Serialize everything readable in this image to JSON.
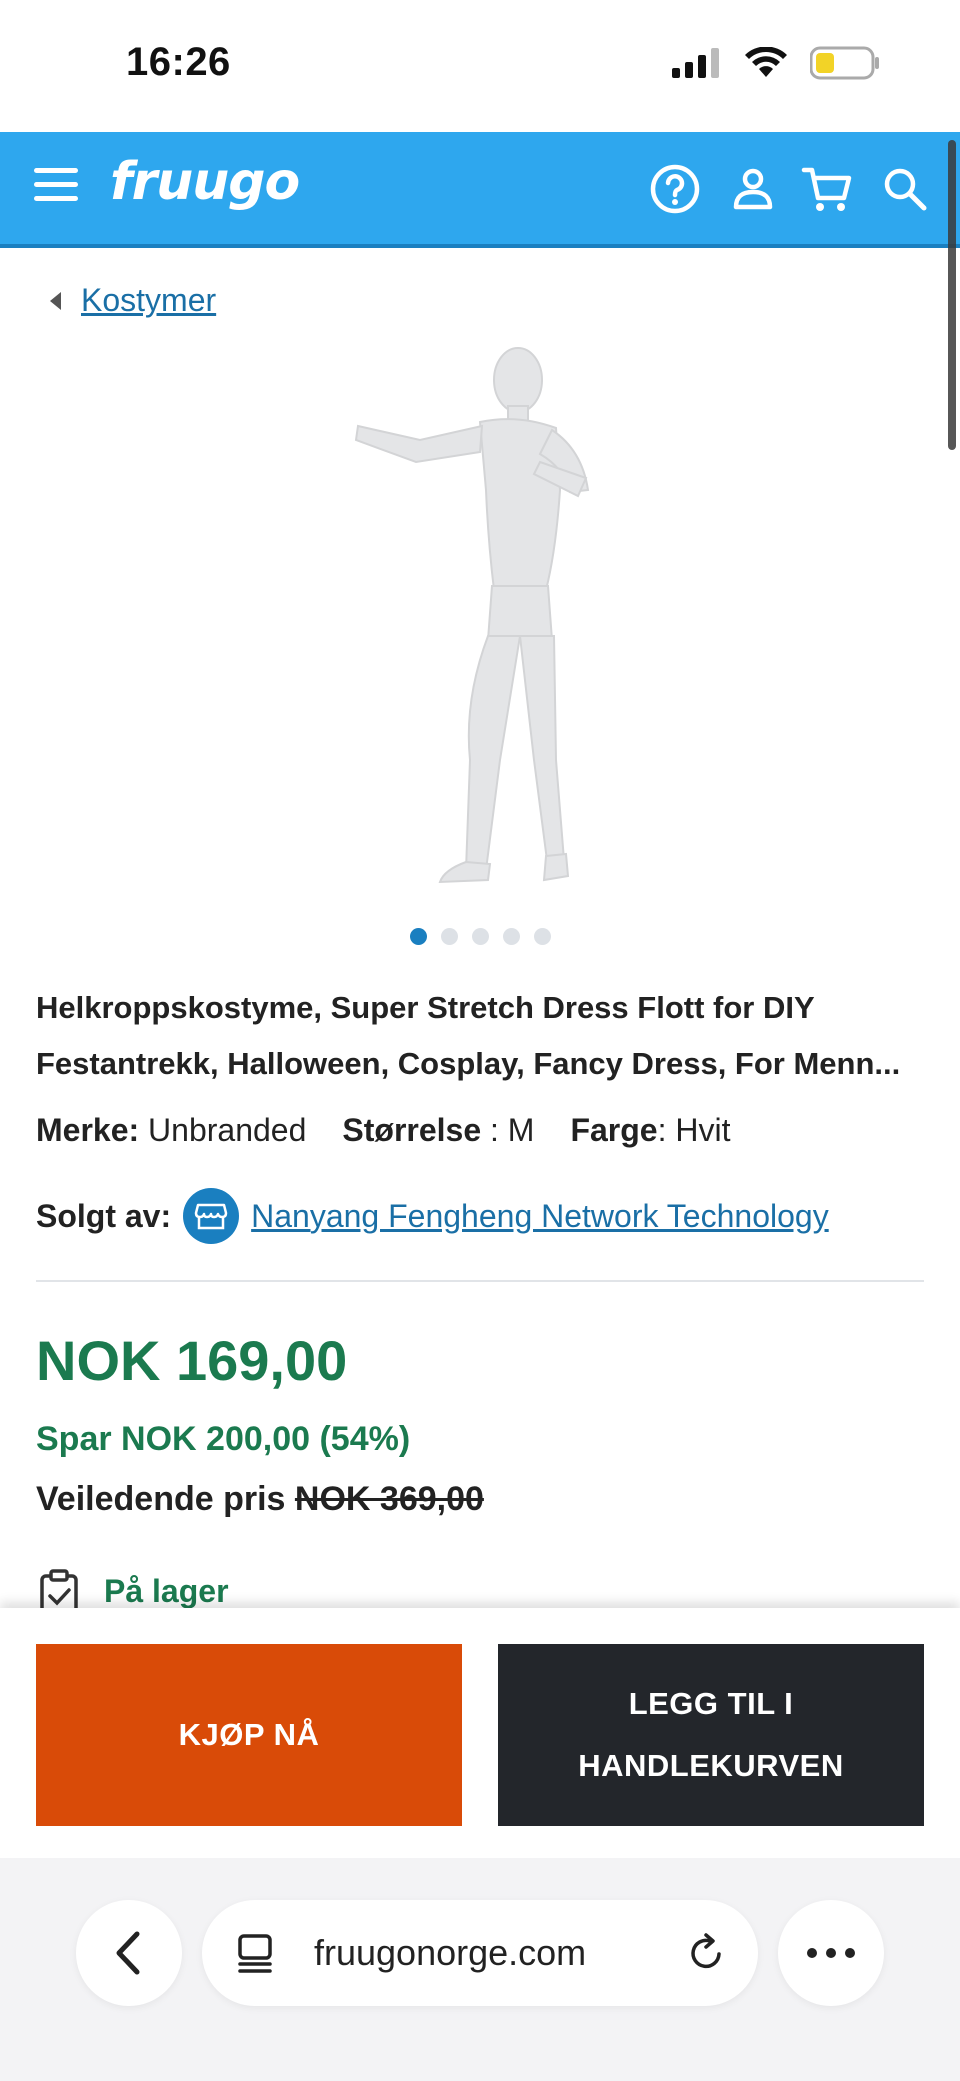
{
  "status_bar": {
    "time": "16:26"
  },
  "header": {
    "logo": "fruugo"
  },
  "breadcrumb": {
    "label": "Kostymer"
  },
  "gallery": {
    "total_images": 5,
    "active_index": 0
  },
  "product": {
    "title": "Helkroppskostyme, Super Stretch Dress Flott for DIY Festantrekk, Halloween, Cosplay, Fancy Dress, For Menn...",
    "brand_label": "Merke:",
    "brand_value": "Unbranded",
    "size_label": "Størrelse",
    "size_value": ": M",
    "color_label": "Farge",
    "color_value": ": Hvit",
    "seller_label": "Solgt av:",
    "seller_name": "Nanyang Fengheng Network Technology"
  },
  "pricing": {
    "price": "NOK 169,00",
    "savings": "Spar NOK 200,00 (54%)",
    "rrp_label": "Veiledende pris",
    "rrp_value": "NOK 369,00",
    "stock": "På lager"
  },
  "actions": {
    "buy_now": "KJØP NÅ",
    "add_to_cart": "LEGG TIL I HANDLEKURVEN"
  },
  "browser": {
    "url": "fruugonorge.com"
  },
  "colors": {
    "header_blue": "#2ea7ee",
    "price_green": "#1b7a4f",
    "buy_orange": "#d94b08",
    "cart_dark": "#23262b",
    "link_blue": "#1a6fa6"
  }
}
